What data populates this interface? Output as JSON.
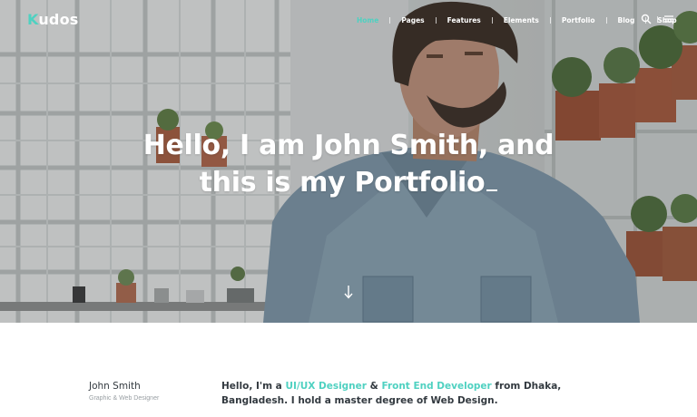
{
  "brand": {
    "logo_first": "K",
    "logo_rest": "udos",
    "accent": "#4fd1c1"
  },
  "nav": {
    "items": [
      {
        "label": "Home",
        "active": true
      },
      {
        "label": "Pages"
      },
      {
        "label": "Features"
      },
      {
        "label": "Elements"
      },
      {
        "label": "Portfolio"
      },
      {
        "label": "Blog"
      },
      {
        "label": "Shop"
      }
    ],
    "icons": [
      "search-icon",
      "menu-icon"
    ]
  },
  "hero": {
    "line1": "Hello, I am John Smith, and",
    "line2": "this is my Portfolio",
    "scroll_icon": "arrow-down-icon"
  },
  "about": {
    "name": "John Smith",
    "role": "Graphic & Web Designer",
    "intro_pre": "Hello, I'm a ",
    "intro_hl1": "UI/UX Designer",
    "intro_mid": " & ",
    "intro_hl2": "Front End Developer",
    "intro_post": " from Dhaka, Bangladesh. I hold a master degree of Web Design."
  }
}
